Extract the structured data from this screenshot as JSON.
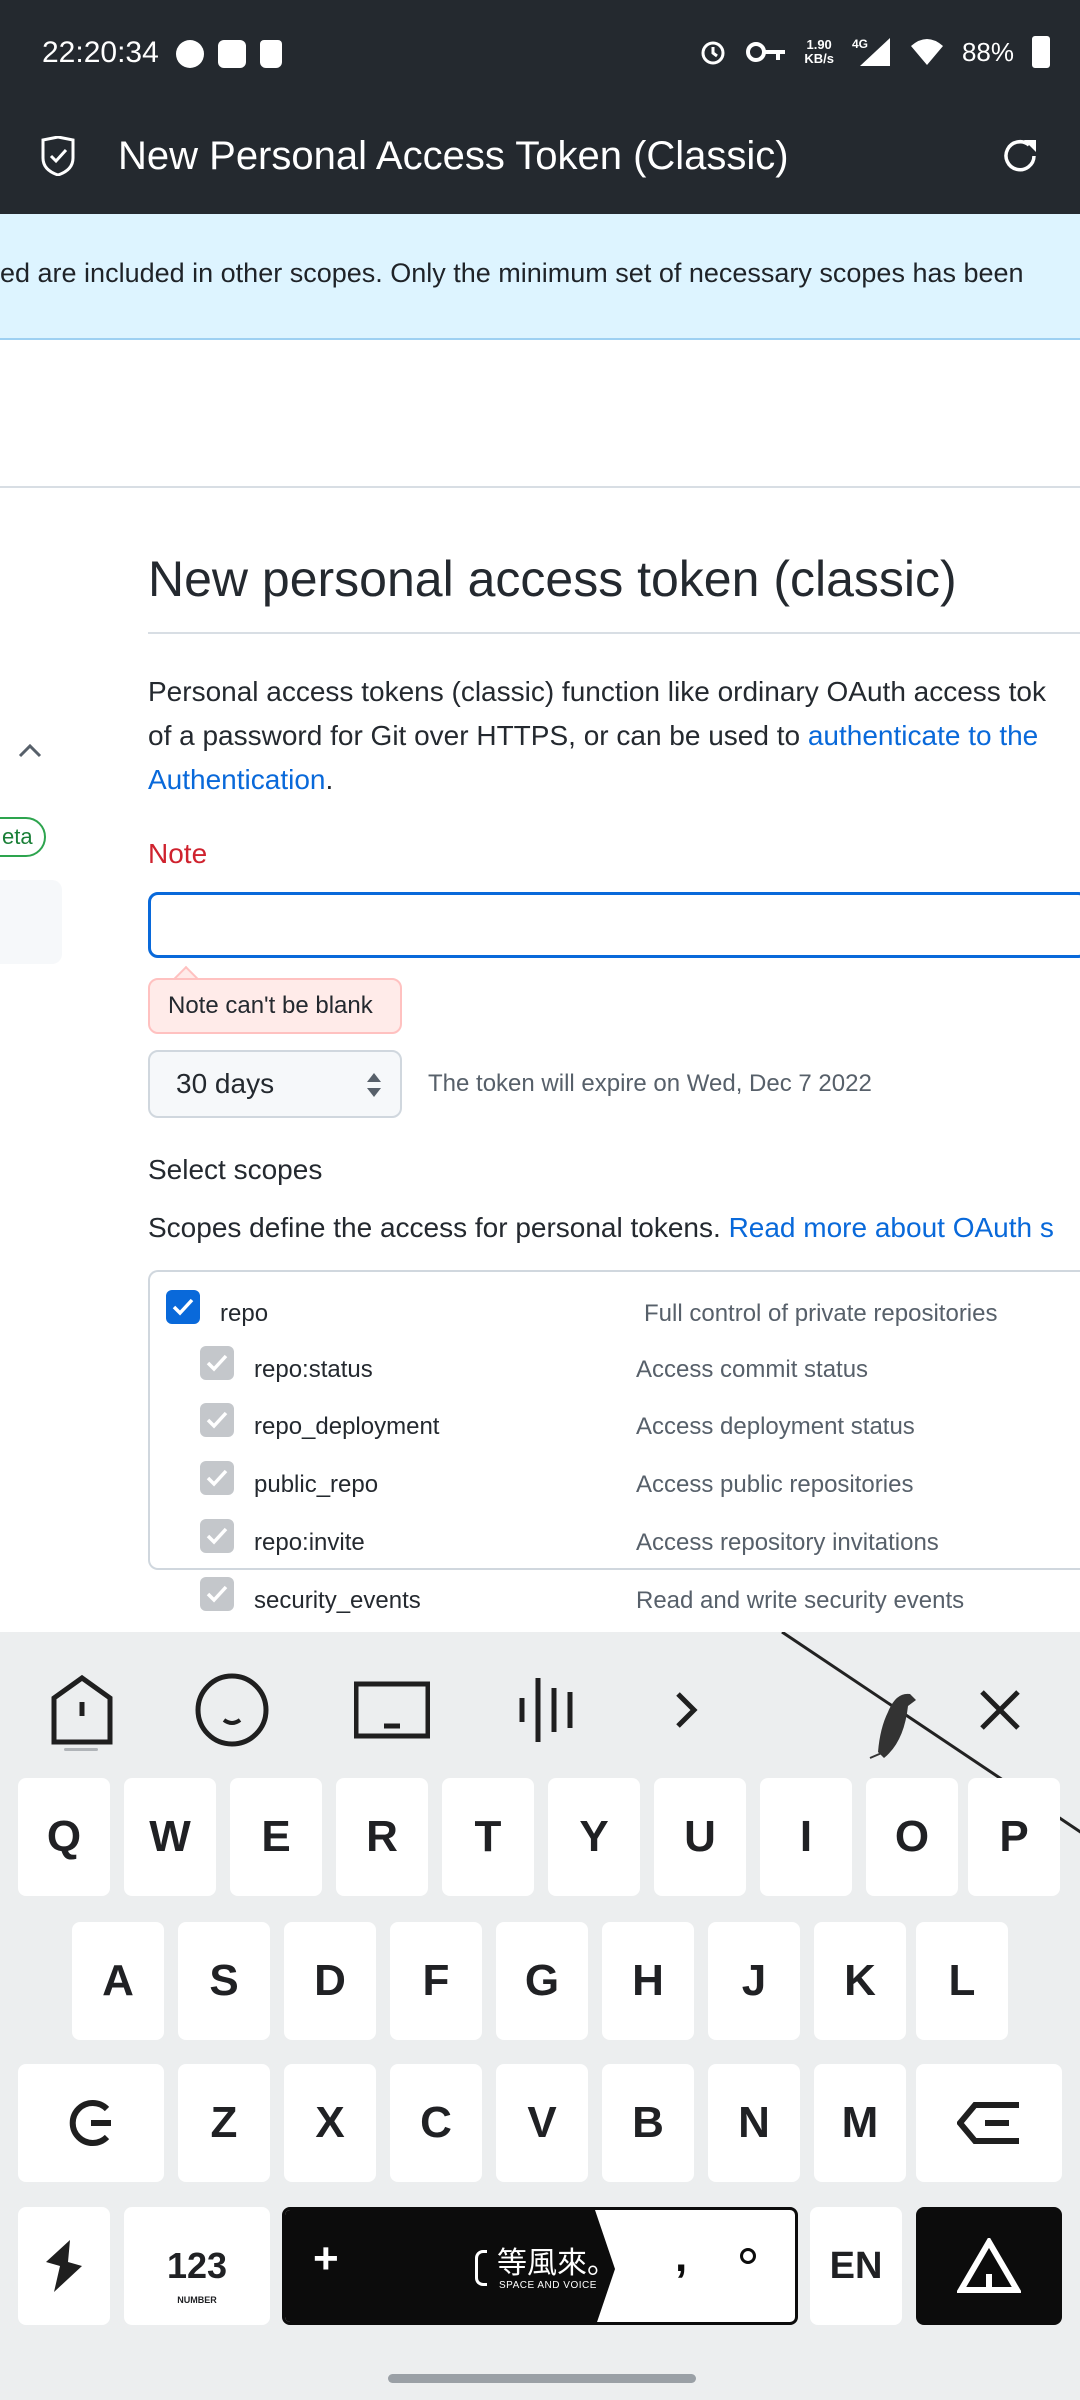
{
  "status_bar": {
    "time": "22:20:34",
    "net_speed_value": "1.90",
    "net_speed_unit": "KB/s",
    "network": "4G",
    "battery": "88%"
  },
  "app_bar": {
    "title": "New Personal Access Token (Classic)",
    "icons": {
      "left": "shield-check-icon",
      "right": "refresh-icon"
    }
  },
  "flash": {
    "text": "ed are included in other scopes. Only the minimum set of necessary scopes has been"
  },
  "sidebar": {
    "badge": "eta"
  },
  "form": {
    "heading": "New personal access token (classic)",
    "description_line1": "Personal access tokens (classic) function like ordinary OAuth access tok",
    "description_line2_pre": "of a password for Git over HTTPS, or can be used to ",
    "description_line2_link": "authenticate to the",
    "description_line3_link": "Authentication",
    "description_line3_post": ".",
    "note_label": "Note",
    "note_value": "",
    "note_error": "Note can't be blank",
    "expiration_selected": "30 days",
    "expiration_text": "The token will expire on Wed, Dec 7 2022",
    "scopes_title": "Select scopes",
    "scopes_desc": "Scopes define the access for personal tokens. ",
    "scopes_link": "Read more about OAuth s",
    "scopes": [
      {
        "name": "repo",
        "description": "Full control of private repositories",
        "checked": true
      },
      {
        "name": "repo:status",
        "description": "Access commit status",
        "checked": true
      },
      {
        "name": "repo_deployment",
        "description": "Access deployment status",
        "checked": true
      },
      {
        "name": "public_repo",
        "description": "Access public repositories",
        "checked": true
      },
      {
        "name": "repo:invite",
        "description": "Access repository invitations",
        "checked": true
      },
      {
        "name": "security_events",
        "description": "Read and write security events",
        "checked": true
      }
    ]
  },
  "keyboard": {
    "row1": [
      "Q",
      "W",
      "E",
      "R",
      "T",
      "Y",
      "U",
      "I",
      "O",
      "P"
    ],
    "row2": [
      "A",
      "S",
      "D",
      "F",
      "G",
      "H",
      "J",
      "K",
      "L"
    ],
    "row3": [
      "Z",
      "X",
      "C",
      "V",
      "B",
      "N",
      "M"
    ],
    "num_key": "123",
    "num_key_sub": "NUMBER",
    "space_plus": "+",
    "space_cjk": "等風來。",
    "space_sub": "SPACE AND VOICE",
    "space_comma": ",",
    "lang_key": "EN"
  },
  "colors": {
    "header_bg": "#24292f",
    "flash_bg": "#ddf4ff",
    "link": "#0969da",
    "error": "#cf222e",
    "keyboard_bg": "#eceeef"
  }
}
